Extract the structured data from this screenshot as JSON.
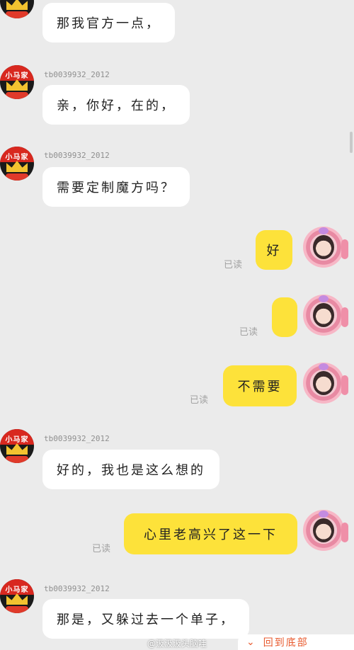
{
  "shop": {
    "avatar_text": "小马家",
    "username": "tb0039932_2012"
  },
  "messages": [
    {
      "side": "left",
      "text": "那我官方一点，"
    },
    {
      "side": "left",
      "username": "tb0039932_2012",
      "text": "亲，你好，在的，"
    },
    {
      "side": "left",
      "username": "tb0039932_2012",
      "text": "需要定制魔方吗？"
    },
    {
      "side": "right",
      "text": "好",
      "status": "已读"
    },
    {
      "side": "right",
      "text": "",
      "status": "已读"
    },
    {
      "side": "right",
      "text": "不需要",
      "status": "已读"
    },
    {
      "side": "left",
      "username": "tb0039932_2012",
      "text": "好的，我也是这么想的"
    },
    {
      "side": "right",
      "text": "心里老高兴了这一下",
      "status": "已读"
    },
    {
      "side": "left",
      "username": "tb0039932_2012",
      "text": "那是，又躲过去一个单子，"
    }
  ],
  "footer": {
    "watermark": "@汲汲汲头脑哇",
    "back_to_bottom": "回到底部"
  },
  "colors": {
    "background": "#ebebeb",
    "my_bubble": "#fde23a",
    "their_bubble": "#ffffff",
    "accent": "#e85a2e"
  }
}
